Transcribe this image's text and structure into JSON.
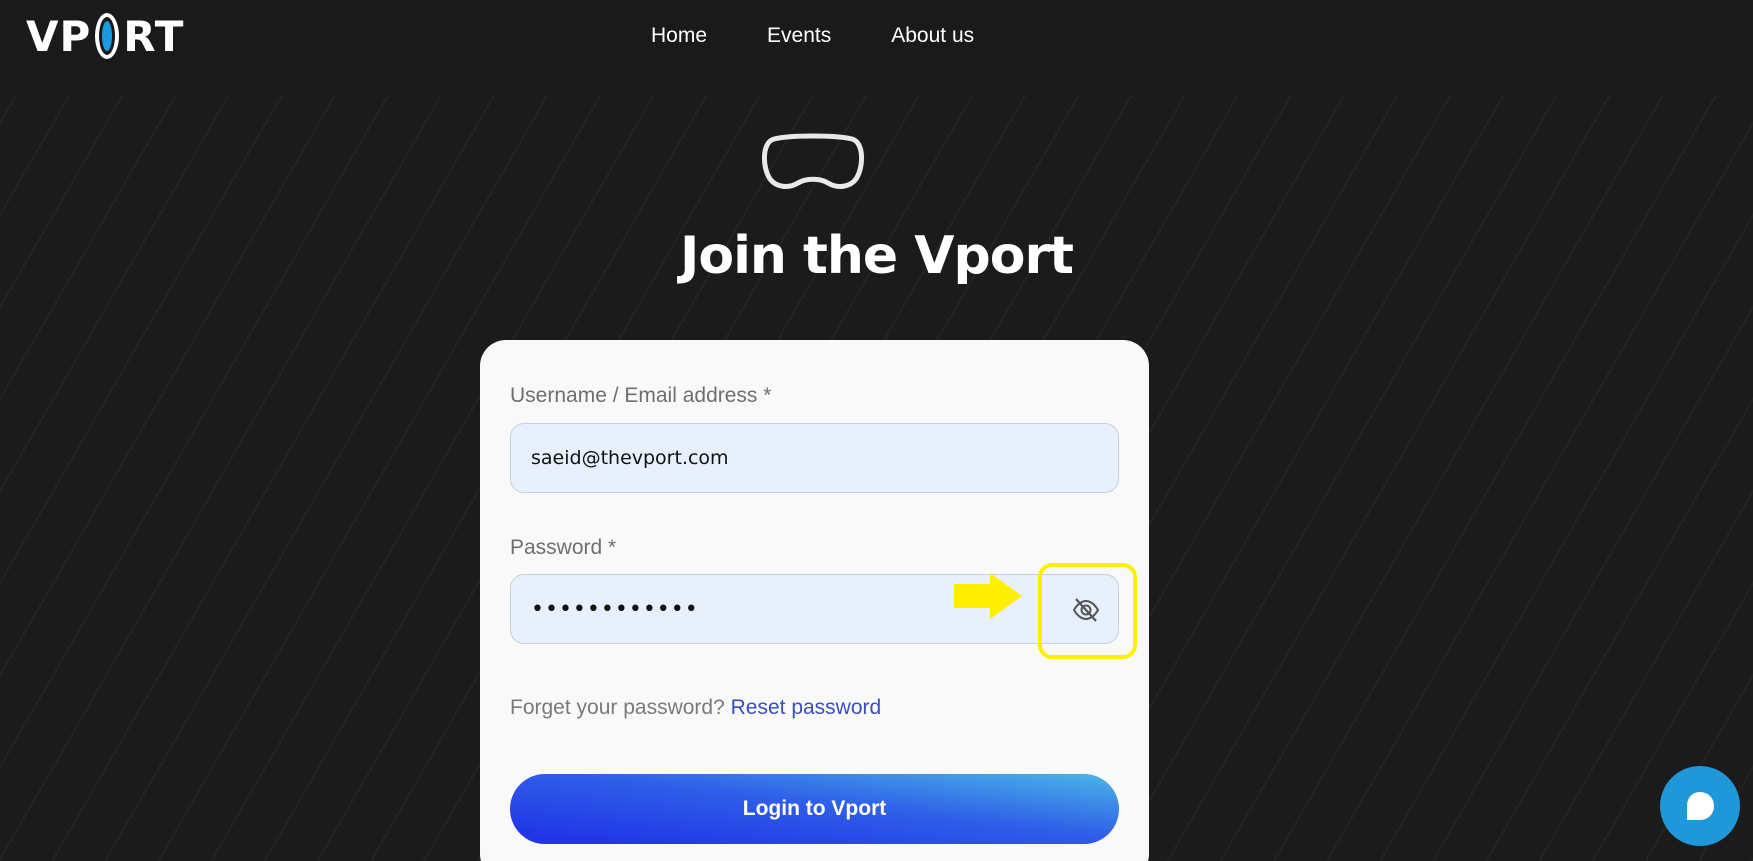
{
  "logo": {
    "text_left": "VP",
    "text_right": "RT"
  },
  "nav": {
    "home": "Home",
    "events": "Events",
    "about": "About us"
  },
  "hero": {
    "title": "Join the Vport",
    "icon": "vr-headset-icon"
  },
  "form": {
    "username_label": "Username / Email address *",
    "username_value": "saeid@thevport.com",
    "password_label": "Password *",
    "password_masked": "••••••••••••",
    "forgot_text": "Forget your password?",
    "reset_link": "Reset password",
    "login_label": "Login to Vport"
  },
  "annotation": {
    "highlight_color": "#ffef00",
    "target": "toggle-password-visibility"
  },
  "colors": {
    "background": "#1b1b1b",
    "accent": "#1f98da",
    "link": "#3a4fc0"
  }
}
